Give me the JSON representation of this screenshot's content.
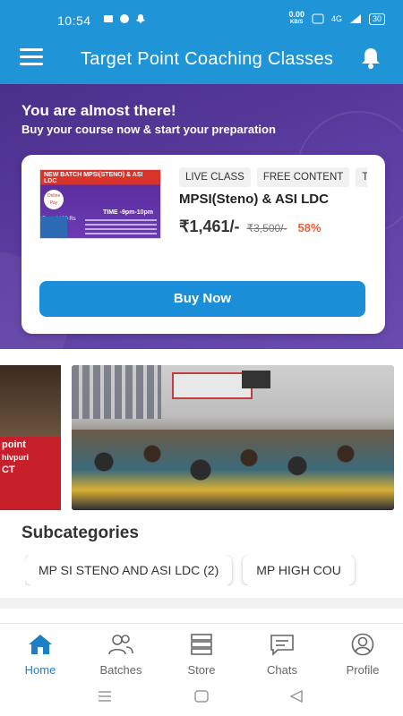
{
  "status_bar": {
    "time": "10:54",
    "net_speed": "0.00",
    "net_unit": "KB/S",
    "network": "4G",
    "battery": "30"
  },
  "app_bar": {
    "title": "Target Point Coaching Classes"
  },
  "hero": {
    "heading": "You are almost there!",
    "subheading": "Buy your course now & start your preparation",
    "course": {
      "tags": [
        "LIVE CLASS",
        "FREE CONTENT",
        "TE"
      ],
      "name": "MPSI(Steno) & ASI LDC",
      "price": "₹1,461/-",
      "original_price": "₹3,500/-",
      "discount": "58%",
      "thumb_title": "NEW BATCH MPSI(STENO) & ASI LDC",
      "thumb_time": "TIME -9pm-10pm",
      "thumb_fees": "Fees-1499 Rs"
    },
    "buy_button": "Buy Now"
  },
  "banner": {
    "left_text": [
      "point",
      "hivpuri",
      "CT"
    ]
  },
  "subcategories": {
    "title": "Subcategories",
    "items": [
      "MP SI STENO AND ASI LDC (2)",
      "MP HIGH COU"
    ]
  },
  "bottom_nav": {
    "items": [
      {
        "label": "Home",
        "icon": "home-icon",
        "active": true
      },
      {
        "label": "Batches",
        "icon": "batches-icon",
        "active": false
      },
      {
        "label": "Store",
        "icon": "store-icon",
        "active": false
      },
      {
        "label": "Chats",
        "icon": "chats-icon",
        "active": false
      },
      {
        "label": "Profile",
        "icon": "profile-icon",
        "active": false
      }
    ]
  },
  "colors": {
    "primary": "#1f95d8",
    "hero": "#5b3ca0",
    "accent_discount": "#e8623a",
    "nav_active": "#1f7fc6"
  }
}
